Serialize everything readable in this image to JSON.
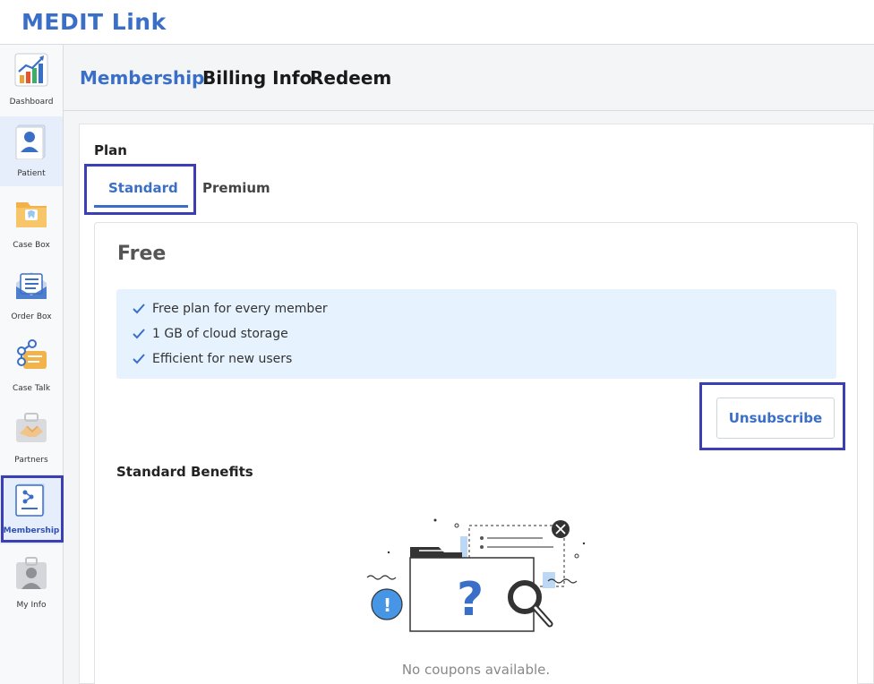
{
  "app": {
    "logo": "MEDIT Link"
  },
  "sidebar": {
    "items": [
      {
        "label": "Dashboard"
      },
      {
        "label": "Patient"
      },
      {
        "label": "Case Box"
      },
      {
        "label": "Order Box"
      },
      {
        "label": "Case Talk"
      },
      {
        "label": "Partners"
      },
      {
        "label": "Membership"
      },
      {
        "label": "My Info"
      }
    ]
  },
  "nav": {
    "tabs": [
      {
        "label": "Membership"
      },
      {
        "label": "Billing Info"
      },
      {
        "label": "Redeem"
      }
    ]
  },
  "plan": {
    "title": "Plan",
    "tabs": [
      {
        "label": "Standard"
      },
      {
        "label": "Premium"
      }
    ],
    "name": "Free",
    "features": [
      "Free plan for every member",
      "1 GB of cloud storage",
      "Efficient for new users"
    ],
    "unsubscribe_label": "Unsubscribe",
    "benefits_title": "Standard Benefits",
    "empty_text": "No coupons available."
  },
  "colors": {
    "accent": "#3a6fc8",
    "highlight_frame": "#3b3fb3",
    "feature_bg": "#e6f2fd"
  }
}
